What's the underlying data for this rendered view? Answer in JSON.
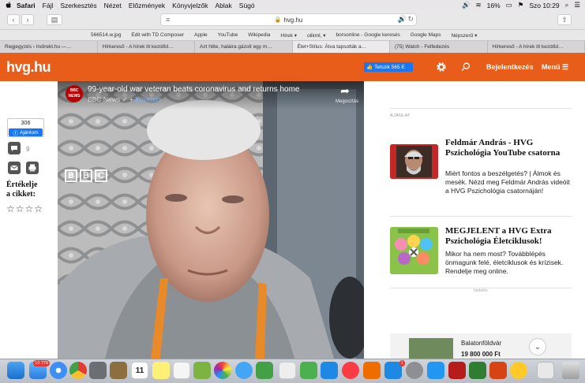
{
  "menubar": {
    "items": [
      "Safari",
      "Fájl",
      "Szerkesztés",
      "Nézet",
      "Előzmények",
      "Könyvjelzők",
      "Ablak",
      "Súgó"
    ],
    "battery": "16%",
    "clock": "Szo 10:29"
  },
  "toolbar": {
    "url": "hvg.hu"
  },
  "bookmarks": [
    "566514.w.jpg",
    "Edit with TD Composer",
    "Apple",
    "YouTube",
    "Wikipedia",
    "Hírek ▾",
    "olikml, ▾",
    "borsonline - Google keresés",
    "Google Maps",
    "Népszerű ▾"
  ],
  "tabs": [
    {
      "label": "Regjegyzés ‹ Indirekt.hu —…",
      "active": false
    },
    {
      "label": "Hírkereső - A hírek itt kezdőd…",
      "active": false
    },
    {
      "label": "Azt hitte, haláira gázolt egy m…",
      "active": false
    },
    {
      "label": "Élet+Stílus: Átva tapsolták a…",
      "active": true
    },
    {
      "label": "(75) Watch - Felfedezés",
      "active": false
    },
    {
      "label": "Hírkereső - A hírek itt kezdőd…",
      "active": false
    }
  ],
  "header": {
    "logo": "hvg.hu",
    "fb_like": "Tetszik 565 E",
    "login": "Bejelentkezés",
    "menu": "Menü ☰"
  },
  "share": {
    "count": "306",
    "recommend": "Ajánlom",
    "comments": "9",
    "rate_prompt_1": "Értékelje",
    "rate_prompt_2": "a cikket:",
    "stars": "☆☆☆☆"
  },
  "video": {
    "channel_badge": "BBC NEWS",
    "title": "99-year-old war veteran beats coronavirus and returns home",
    "channel": "BBC News",
    "follow": "Követem",
    "share_label": "Megosztás",
    "watermark": [
      "B",
      "B",
      "C"
    ]
  },
  "sidebar": {
    "section_label": "AJÁNLAT",
    "promos": [
      {
        "title": "Feldmár András - HVG Pszichológia YouTube csatorna",
        "text": "Miért fontos a beszélgetés? | Álmok és mesék. Nézd meg Feldmár András videóit a HVG Pszichológia csatornáján!"
      },
      {
        "title": "MEGJELENT a HVG Extra Pszichológia Életciklusok!",
        "text": "Mikor ha nem most? Továbblépés önmagunk felé, életciklusok és krízisek. Rendelje meg online."
      }
    ],
    "ad_label": "hirdetés",
    "ad": {
      "location": "Balatonföldvár",
      "price": "19 800 000 Ft"
    }
  },
  "dock": {
    "mail_badge": "10 779",
    "calendar_day": "11",
    "appstore_badge": "1"
  }
}
